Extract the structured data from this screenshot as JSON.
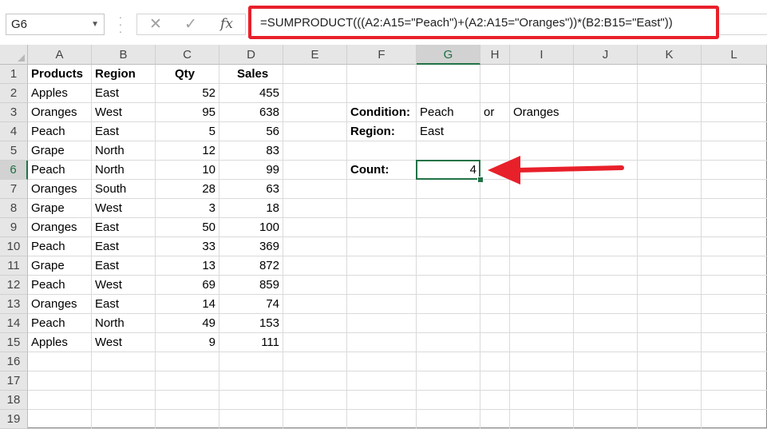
{
  "formula_bar": {
    "name_box": "G6",
    "formula": "=SUMPRODUCT(((A2:A15=\"Peach\")+(A2:A15=\"Oranges\"))*(B2:B15=\"East\"))",
    "cancel_glyph": "✕",
    "enter_glyph": "✓",
    "fx_label": "fx"
  },
  "columns": [
    "A",
    "B",
    "C",
    "D",
    "E",
    "F",
    "G",
    "H",
    "I",
    "J",
    "K",
    "L"
  ],
  "rows": [
    "1",
    "2",
    "3",
    "4",
    "5",
    "6",
    "7",
    "8",
    "9",
    "10",
    "11",
    "12",
    "13",
    "14",
    "15",
    "16",
    "17",
    "18",
    "19"
  ],
  "table": {
    "headers": [
      "Products",
      "Region",
      "Qty",
      "Sales"
    ],
    "rows": [
      [
        "Apples",
        "East",
        "52",
        "455"
      ],
      [
        "Oranges",
        "West",
        "95",
        "638"
      ],
      [
        "Peach",
        "East",
        "5",
        "56"
      ],
      [
        "Grape",
        "North",
        "12",
        "83"
      ],
      [
        "Peach",
        "North",
        "10",
        "99"
      ],
      [
        "Oranges",
        "South",
        "28",
        "63"
      ],
      [
        "Grape",
        "West",
        "3",
        "18"
      ],
      [
        "Oranges",
        "East",
        "50",
        "100"
      ],
      [
        "Peach",
        "East",
        "33",
        "369"
      ],
      [
        "Grape",
        "East",
        "13",
        "872"
      ],
      [
        "Peach",
        "West",
        "69",
        "859"
      ],
      [
        "Oranges",
        "East",
        "14",
        "74"
      ],
      [
        "Peach",
        "North",
        "49",
        "153"
      ],
      [
        "Apples",
        "West",
        "9",
        "111"
      ]
    ]
  },
  "criteria": {
    "condition_label": "Condition:",
    "condition_value1": "Peach",
    "or_text": "or",
    "condition_value2": "Oranges",
    "region_label": "Region:",
    "region_value": "East",
    "count_label": "Count:",
    "count_value": "4"
  },
  "selected": {
    "column": "G",
    "row": "6"
  },
  "colors": {
    "annotation": "#e8202a",
    "selection": "#217346"
  }
}
